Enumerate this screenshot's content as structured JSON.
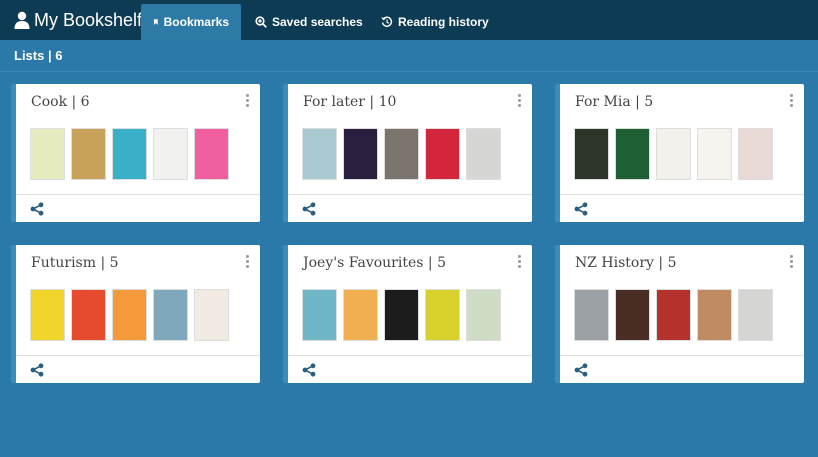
{
  "nav": {
    "brand": "My Bookshelf",
    "tabs": [
      {
        "label": "Bookmarks",
        "active": true
      },
      {
        "label": "Saved searches",
        "active": false
      },
      {
        "label": "Reading history",
        "active": false
      }
    ]
  },
  "subheader": {
    "label": "Lists | 6"
  },
  "colors": {
    "navbar": "#0d3b54",
    "background": "#2b79a8",
    "active_tab": "#2e7aa6",
    "card_accent": "#3a8db9"
  },
  "lists": [
    {
      "title": "Cook | 6",
      "cover_colors": [
        "#e6ecc0",
        "#c8a25a",
        "#3ab0c8",
        "#f1f1ef",
        "#f05fa0"
      ]
    },
    {
      "title": "For later | 10",
      "cover_colors": [
        "#a7c9cf",
        "#2b1f3f",
        "#7c756e",
        "#d3253c",
        "#d6d6d4"
      ]
    },
    {
      "title": "For Mia | 5",
      "cover_colors": [
        "#2d3428",
        "#1e5f33",
        "#f3f1ec",
        "#f7f3ee",
        "#e9d9d4"
      ]
    },
    {
      "title": "Futurism | 5",
      "cover_colors": [
        "#f0d52a",
        "#e54b2c",
        "#f59a3a",
        "#7fa8bd",
        "#f1ebe2"
      ]
    },
    {
      "title": "Joey's Favourites | 5",
      "cover_colors": [
        "#6fb6c6",
        "#f0b050",
        "#1c1c1c",
        "#d8d12c",
        "#cfdcc6"
      ]
    },
    {
      "title": "NZ History | 5",
      "cover_colors": [
        "#9aa0a3",
        "#4a2d24",
        "#b5312c",
        "#c08a62",
        "#d5d5d3"
      ]
    }
  ]
}
